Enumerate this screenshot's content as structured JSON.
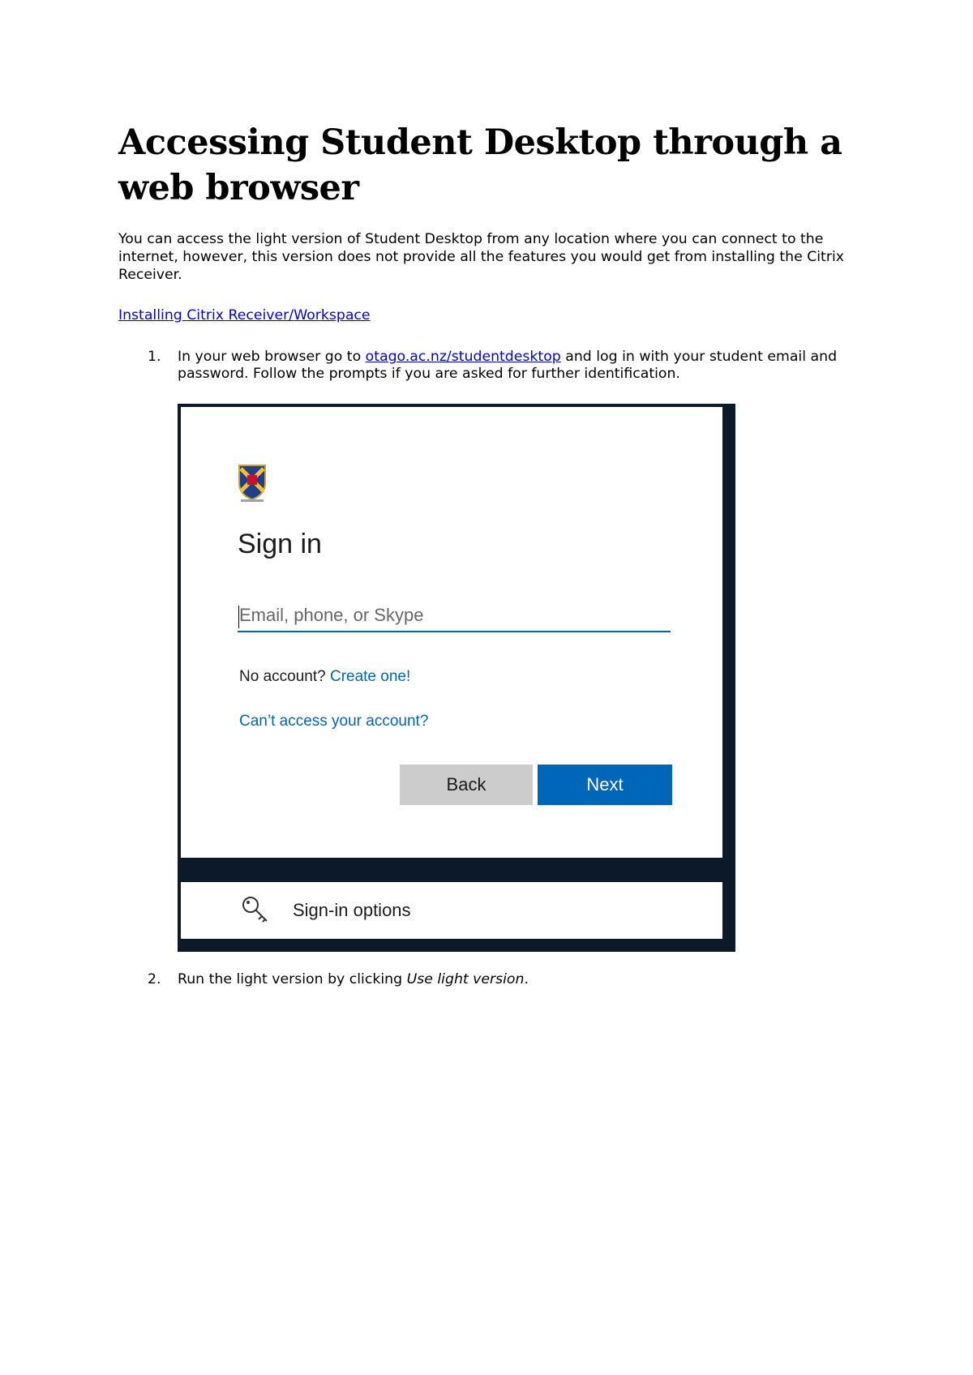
{
  "document": {
    "title": "Accessing Student Desktop through a web browser",
    "intro": "You can access the light version of Student Desktop from any location where you can connect to the internet, however, this version does not provide all the features you would get from installing the Citrix Receiver.",
    "install_link": "Installing Citrix Receiver/Workspace",
    "steps": [
      {
        "number": "1.",
        "text_before": "In your web browser go to ",
        "link": "otago.ac.nz/studentdesktop",
        "text_after": " and log in with your student email and password. Follow the prompts if you are asked for further identification."
      },
      {
        "number": "2.",
        "text_before": "Run the light version by clicking ",
        "emphasis": "Use light version",
        "text_after": "."
      }
    ]
  },
  "signin": {
    "crest_icon": "university-crest-icon",
    "title": "Sign in",
    "email_placeholder": "Email, phone, or Skype",
    "no_account_text": "No account? ",
    "create_link": "Create one!",
    "cant_access_link": "Can’t access your account?",
    "back_label": "Back",
    "next_label": "Next",
    "options_icon": "key-icon",
    "options_label": "Sign-in options",
    "colors": {
      "accent": "#0067b8",
      "frame": "#0c1929",
      "back_button": "#cccccc"
    }
  }
}
